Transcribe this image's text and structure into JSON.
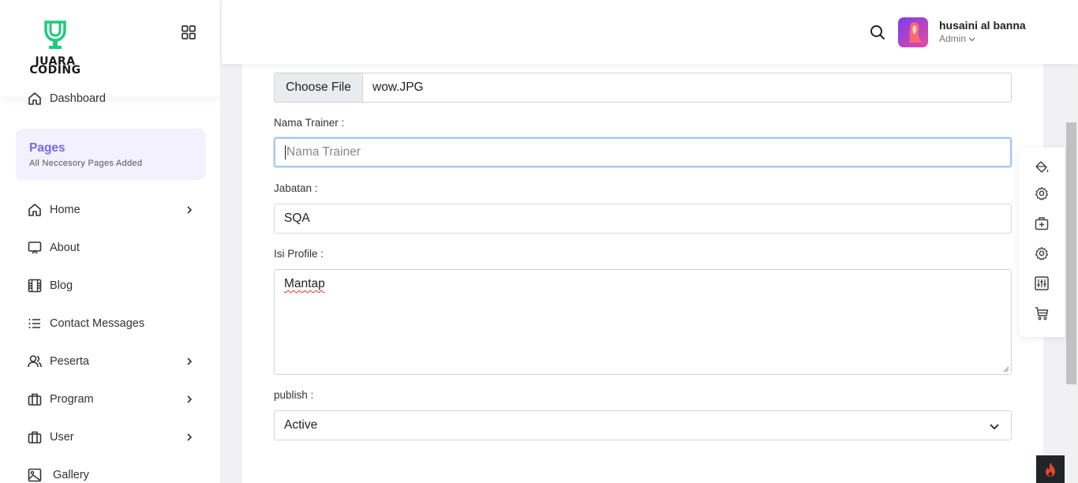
{
  "brand": {
    "logo_line1": "JUARA",
    "logo_line2": "CODING",
    "accent": "#1fcb7c"
  },
  "sidebar": {
    "dashboard": "Dashboard",
    "pages_title": "Pages",
    "pages_subtitle": "All Neccesory Pages Added",
    "items": [
      {
        "label": "Home",
        "icon": "home-icon",
        "has_children": true
      },
      {
        "label": "About",
        "icon": "monitor-icon",
        "has_children": false
      },
      {
        "label": "Blog",
        "icon": "film-icon",
        "has_children": false
      },
      {
        "label": "Contact Messages",
        "icon": "list-icon",
        "has_children": false
      },
      {
        "label": "Peserta",
        "icon": "users-icon",
        "has_children": true
      },
      {
        "label": "Program",
        "icon": "briefcase-icon",
        "has_children": true
      },
      {
        "label": "User",
        "icon": "briefcase-icon",
        "has_children": true
      },
      {
        "label": "Gallery",
        "icon": "image-icon",
        "has_children": false
      }
    ]
  },
  "header": {
    "user_name": "husaini al banna",
    "user_role": "Admin"
  },
  "form": {
    "file_button": "Choose File",
    "file_name": "wow.JPG",
    "nama_label": "Nama Trainer :",
    "nama_placeholder": "Nama Trainer",
    "jabatan_label": "Jabatan :",
    "jabatan_value": "SQA",
    "profile_label": "Isi Profile :",
    "profile_value": "Mantap",
    "publish_label": "publish :",
    "publish_value": "Active"
  },
  "tools": [
    "paint-bucket-icon",
    "gear-icon",
    "medical-case-icon",
    "gear-icon",
    "sliders-icon",
    "cart-icon"
  ],
  "colors": {
    "pages_accent": "#7b68ee",
    "focus_border": "#a8c6f0",
    "fire": "#e8462a"
  }
}
